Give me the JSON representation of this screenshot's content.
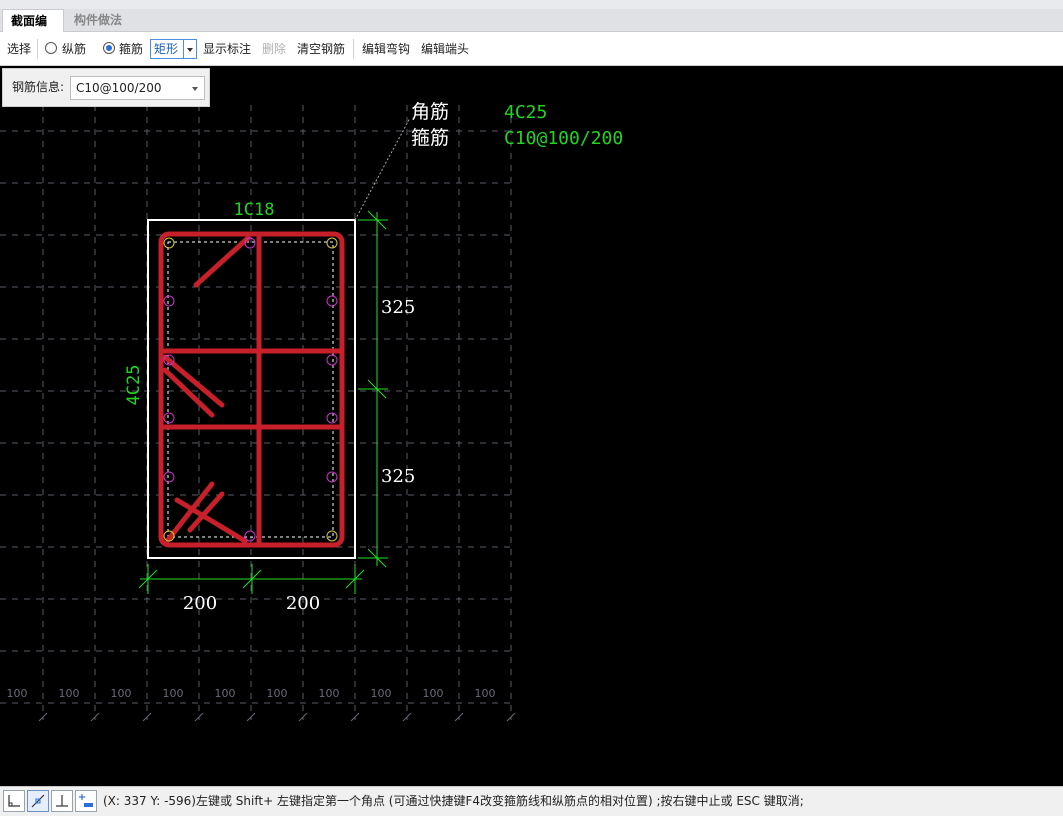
{
  "tabs": [
    {
      "label": "截面编辑"
    },
    {
      "label": "构件做法"
    }
  ],
  "toolbar": {
    "select": "选择",
    "longitudinal": "纵筋",
    "stirrup": "箍筋",
    "shape": "矩形",
    "show_labels": "显示标注",
    "delete": "删除",
    "clear": "清空钢筋",
    "edit_hook": "编辑弯钩",
    "edit_end": "编辑端头"
  },
  "rebar_info": {
    "label": "钢筋信息:",
    "value": "C10@100/200"
  },
  "drawing": {
    "legend": [
      {
        "name": "角筋",
        "value": "4C25"
      },
      {
        "name": "箍筋",
        "value": "C10@100/200"
      }
    ],
    "top_label": "1C18",
    "side_label": "4C25",
    "dims_right": [
      "325",
      "325"
    ],
    "dims_bottom": [
      "200",
      "200"
    ],
    "grid_labels": [
      "100",
      "100",
      "100",
      "100",
      "100",
      "100",
      "100",
      "100",
      "100",
      "100"
    ],
    "colors": {
      "background": "#000000",
      "rebar": "#c8202a",
      "dimension": "#22e022",
      "label_green": "#22d422",
      "grid": "#5a5a66",
      "section": "#ffffff",
      "bar_magenta": "#cc33cc",
      "bar_yellow": "#d4c832"
    }
  },
  "status": {
    "text": "(X: 337 Y: -596)左键或 Shift+ 左键指定第一个角点 (可通过快捷键F4改变箍筋线和纵筋点的相对位置) ;按右键中止或 ESC 键取消;",
    "icons": [
      "ortho-icon",
      "line-snap-icon",
      "perpendicular-snap-icon",
      "dimension-snap-icon"
    ]
  }
}
